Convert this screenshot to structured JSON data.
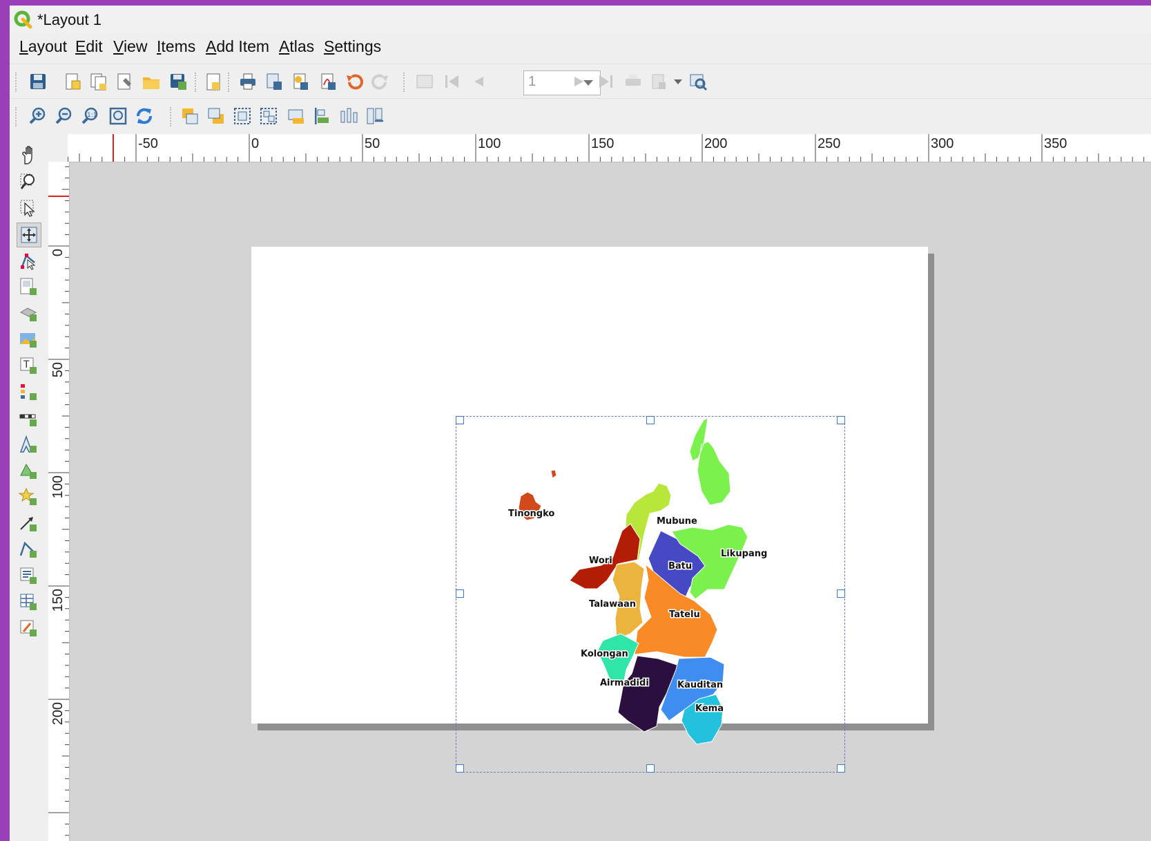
{
  "window": {
    "title": "*Layout 1"
  },
  "menu": [
    "Layout",
    "Edit",
    "View",
    "Items",
    "Add Item",
    "Atlas",
    "Settings"
  ],
  "atlas_toolbar": {
    "page_number": "1"
  },
  "rulers": {
    "horizontal_labels": [
      "-50",
      "0",
      "50",
      "100",
      "150",
      "200",
      "250",
      "300",
      "350"
    ],
    "vertical_labels": [
      "0",
      "50",
      "100",
      "150",
      "200"
    ]
  },
  "map": {
    "labels": [
      "Tinongko",
      "Mubune",
      "Wori",
      "Batu",
      "Likupang",
      "Talawaan",
      "Tatelu",
      "Kolongan",
      "Airmadidi",
      "Kauditan",
      "Kema"
    ],
    "region_colors": {
      "Tinongko": "#d24a1c",
      "Mubune": "#b8e63b",
      "Wori": "#b31d05",
      "Batu": "#4649c4",
      "Likupang": "#7af14c",
      "Talawaan": "#ebb43e",
      "Tatelu": "#fa8a26",
      "Kolongan": "#2fe6a8",
      "Airmadidi": "#2b0f3f",
      "Kauditan": "#3f8df0",
      "Kema": "#22c1dd"
    }
  }
}
